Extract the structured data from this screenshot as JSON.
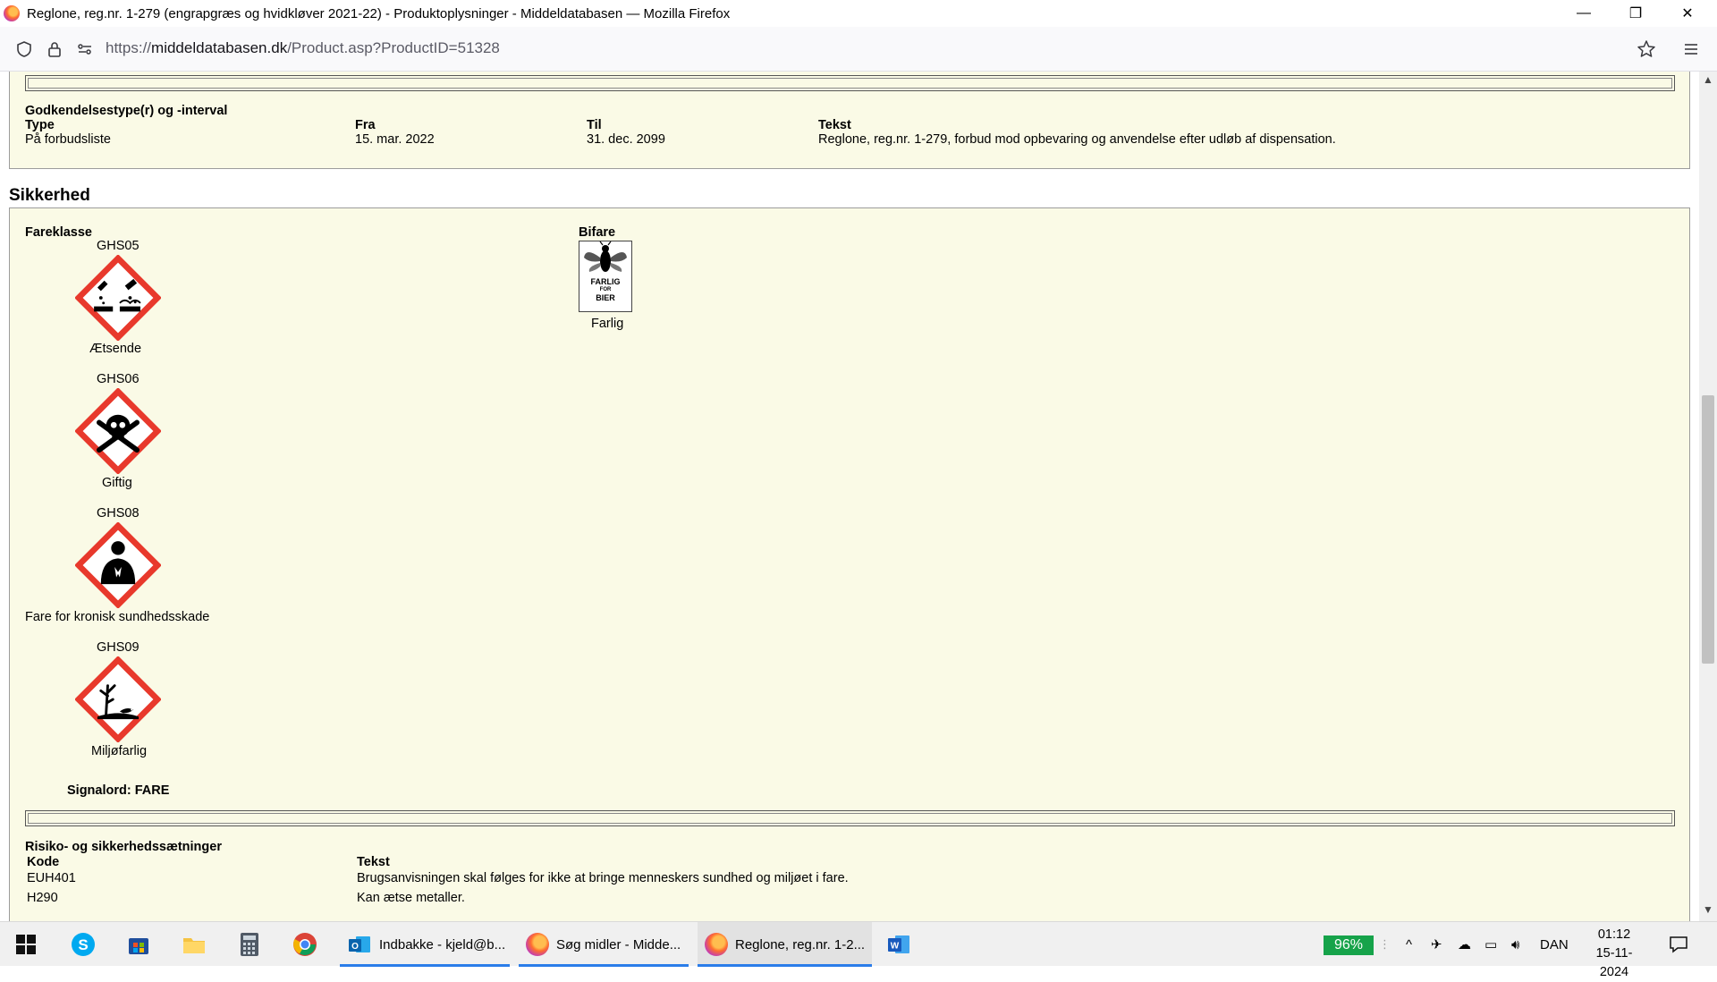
{
  "window": {
    "title": "Reglone, reg.nr. 1-279 (engrapgræs og hvidkløver 2021-22) - Produktoplysninger - Middeldatabasen — Mozilla Firefox",
    "min_glyph": "—",
    "max_glyph": "❐",
    "close_glyph": "✕"
  },
  "urlbar": {
    "scheme": "https://",
    "host": "middeldatabasen.dk",
    "path": "/Product.asp?ProductID=51328"
  },
  "approval": {
    "heading": "Godkendelsestype(r) og -interval",
    "columns": [
      "Type",
      "Fra",
      "Til",
      "Tekst"
    ],
    "row": {
      "type": "På forbudsliste",
      "from": "15. mar. 2022",
      "to": "31. dec. 2099",
      "text": "Reglone, reg.nr. 1-279, forbud mod opbevaring og anvendelse efter udløb af dispensation."
    }
  },
  "safety": {
    "heading": "Sikkerhed",
    "hazard_class_label": "Fareklasse",
    "bee_label": "Bifare",
    "bee_sign": {
      "line1": "FARLIG",
      "line2": "FOR",
      "line3": "BIER"
    },
    "bee_value": "Farlig",
    "pictograms": [
      {
        "code": "GHS05",
        "label": "Ætsende",
        "icon": "corrosive-icon"
      },
      {
        "code": "GHS06",
        "label": "Giftig",
        "icon": "skull-crossbones-icon"
      },
      {
        "code": "GHS08",
        "label": "Fare for kronisk sundhedsskade",
        "icon": "health-hazard-icon"
      },
      {
        "code": "GHS09",
        "label": "Miljøfarlig",
        "icon": "environment-icon"
      }
    ],
    "signal_word": "Signalord: FARE"
  },
  "phrases": {
    "heading": "Risiko- og sikkerhedssætninger",
    "columns": [
      "Kode",
      "Tekst"
    ],
    "rows": [
      {
        "code": "EUH401",
        "text": "Brugsanvisningen skal følges for ikke at bringe menneskers sundhed og miljøet i fare."
      },
      {
        "code": "H290",
        "text": "Kan ætse metaller."
      }
    ]
  },
  "taskbar": {
    "apps": [
      {
        "label": "Indbakke - kjeld@b..."
      },
      {
        "label": "Søg midler - Midde..."
      },
      {
        "label": "Reglone, reg.nr. 1-2..."
      }
    ],
    "battery": "96%",
    "language": "DAN",
    "time": "01:12",
    "date": "15-11-2024"
  },
  "colors": {
    "page_bg": "#fafae6",
    "ghs_red": "#e8392c",
    "taskbar_accent": "#2b7de9",
    "battery": "#16a34a"
  }
}
